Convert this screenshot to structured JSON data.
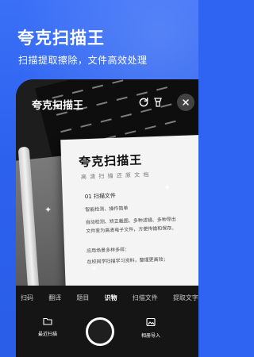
{
  "header": {
    "title": "夸克扫描王",
    "subtitle": "扫描提取擦除，文件高效处理"
  },
  "viewfinder": {
    "brand_label": "夸克扫描王",
    "document": {
      "title": "夸克扫描王",
      "subtitle": "高 清 扫 描   还 原 文 档",
      "heading": "01 扫描文件",
      "lines": [
        "智能检测、操作简单",
        "自动检测、矫正截图、多种滤镜、多种导出",
        "文件变为高清电子文件，方便传输和保存。",
        "",
        "应用场景多样多样：",
        "在校同学扫描学习资料，整理更高效；"
      ]
    }
  },
  "modes": {
    "items": [
      "扫码",
      "翻译",
      "题目",
      "识物",
      "扫描文件",
      "提取文字"
    ],
    "active": "识物"
  },
  "bottom": {
    "left_label": "最近扫描",
    "right_label": "相册导入"
  },
  "colors": {
    "brand_blue": "#2f63f2",
    "camera_bg": "#151515"
  }
}
